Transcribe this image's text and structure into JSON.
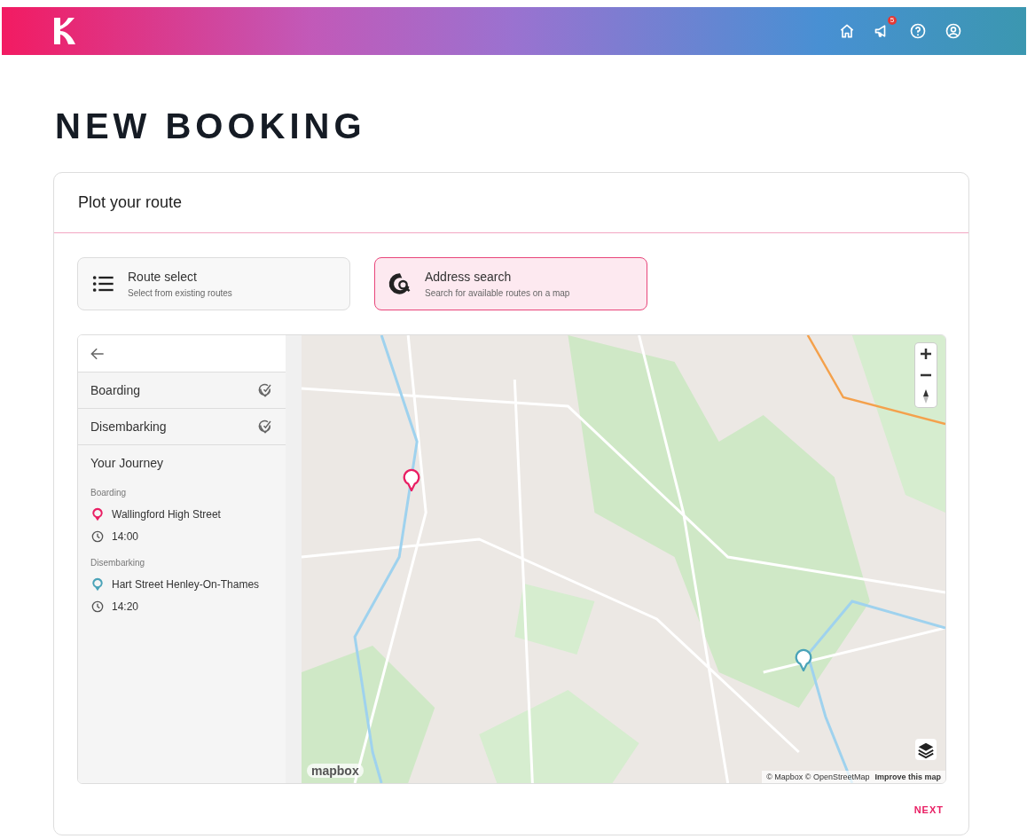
{
  "header": {
    "notification_count": "5"
  },
  "page_title": "NEW BOOKING",
  "card": {
    "title": "Plot your route"
  },
  "modes": [
    {
      "kind": "list",
      "label": "Route select",
      "description": "Select from existing routes",
      "selected": false
    },
    {
      "kind": "globe",
      "label": "Address search",
      "description": "Search for available routes on a map",
      "selected": true
    }
  ],
  "sidebar": {
    "sections": [
      {
        "label": "Boarding"
      },
      {
        "label": "Disembarking"
      }
    ],
    "journey_title": "Your Journey",
    "stops": [
      {
        "heading": "Boarding",
        "place": "Wallingford High Street",
        "time": "14:00",
        "color": "#e91e63"
      },
      {
        "heading": "Disembarking",
        "place": "Hart Street Henley-On-Thames",
        "time": "14:20",
        "color": "#4aa3b8"
      }
    ]
  },
  "map": {
    "logo": "mapbox",
    "attribution": "© Mapbox © OpenStreetMap",
    "improve_link": "Improve this map"
  },
  "next_button": "NEXT"
}
